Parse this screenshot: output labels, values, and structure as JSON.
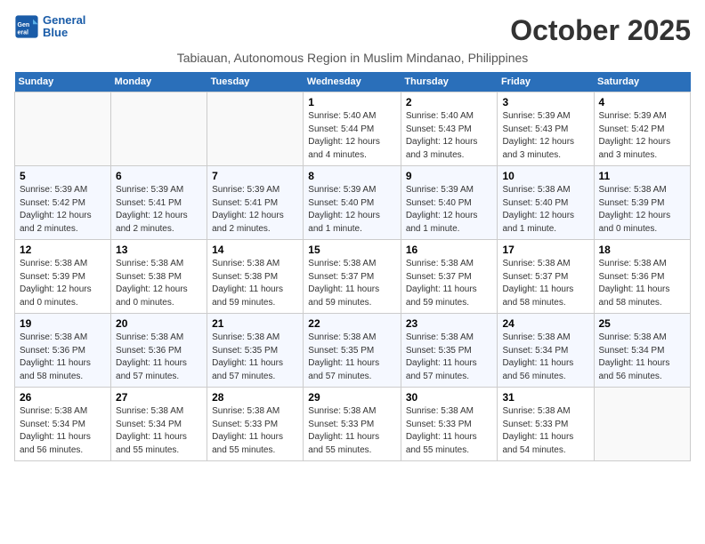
{
  "logo": {
    "line1": "General",
    "line2": "Blue"
  },
  "title": "October 2025",
  "subtitle": "Tabiauan, Autonomous Region in Muslim Mindanao, Philippines",
  "days_of_week": [
    "Sunday",
    "Monday",
    "Tuesday",
    "Wednesday",
    "Thursday",
    "Friday",
    "Saturday"
  ],
  "weeks": [
    [
      {
        "day": "",
        "info": ""
      },
      {
        "day": "",
        "info": ""
      },
      {
        "day": "",
        "info": ""
      },
      {
        "day": "1",
        "info": "Sunrise: 5:40 AM\nSunset: 5:44 PM\nDaylight: 12 hours and 4 minutes."
      },
      {
        "day": "2",
        "info": "Sunrise: 5:40 AM\nSunset: 5:43 PM\nDaylight: 12 hours and 3 minutes."
      },
      {
        "day": "3",
        "info": "Sunrise: 5:39 AM\nSunset: 5:43 PM\nDaylight: 12 hours and 3 minutes."
      },
      {
        "day": "4",
        "info": "Sunrise: 5:39 AM\nSunset: 5:42 PM\nDaylight: 12 hours and 3 minutes."
      }
    ],
    [
      {
        "day": "5",
        "info": "Sunrise: 5:39 AM\nSunset: 5:42 PM\nDaylight: 12 hours and 2 minutes."
      },
      {
        "day": "6",
        "info": "Sunrise: 5:39 AM\nSunset: 5:41 PM\nDaylight: 12 hours and 2 minutes."
      },
      {
        "day": "7",
        "info": "Sunrise: 5:39 AM\nSunset: 5:41 PM\nDaylight: 12 hours and 2 minutes."
      },
      {
        "day": "8",
        "info": "Sunrise: 5:39 AM\nSunset: 5:40 PM\nDaylight: 12 hours and 1 minute."
      },
      {
        "day": "9",
        "info": "Sunrise: 5:39 AM\nSunset: 5:40 PM\nDaylight: 12 hours and 1 minute."
      },
      {
        "day": "10",
        "info": "Sunrise: 5:38 AM\nSunset: 5:40 PM\nDaylight: 12 hours and 1 minute."
      },
      {
        "day": "11",
        "info": "Sunrise: 5:38 AM\nSunset: 5:39 PM\nDaylight: 12 hours and 0 minutes."
      }
    ],
    [
      {
        "day": "12",
        "info": "Sunrise: 5:38 AM\nSunset: 5:39 PM\nDaylight: 12 hours and 0 minutes."
      },
      {
        "day": "13",
        "info": "Sunrise: 5:38 AM\nSunset: 5:38 PM\nDaylight: 12 hours and 0 minutes."
      },
      {
        "day": "14",
        "info": "Sunrise: 5:38 AM\nSunset: 5:38 PM\nDaylight: 11 hours and 59 minutes."
      },
      {
        "day": "15",
        "info": "Sunrise: 5:38 AM\nSunset: 5:37 PM\nDaylight: 11 hours and 59 minutes."
      },
      {
        "day": "16",
        "info": "Sunrise: 5:38 AM\nSunset: 5:37 PM\nDaylight: 11 hours and 59 minutes."
      },
      {
        "day": "17",
        "info": "Sunrise: 5:38 AM\nSunset: 5:37 PM\nDaylight: 11 hours and 58 minutes."
      },
      {
        "day": "18",
        "info": "Sunrise: 5:38 AM\nSunset: 5:36 PM\nDaylight: 11 hours and 58 minutes."
      }
    ],
    [
      {
        "day": "19",
        "info": "Sunrise: 5:38 AM\nSunset: 5:36 PM\nDaylight: 11 hours and 58 minutes."
      },
      {
        "day": "20",
        "info": "Sunrise: 5:38 AM\nSunset: 5:36 PM\nDaylight: 11 hours and 57 minutes."
      },
      {
        "day": "21",
        "info": "Sunrise: 5:38 AM\nSunset: 5:35 PM\nDaylight: 11 hours and 57 minutes."
      },
      {
        "day": "22",
        "info": "Sunrise: 5:38 AM\nSunset: 5:35 PM\nDaylight: 11 hours and 57 minutes."
      },
      {
        "day": "23",
        "info": "Sunrise: 5:38 AM\nSunset: 5:35 PM\nDaylight: 11 hours and 57 minutes."
      },
      {
        "day": "24",
        "info": "Sunrise: 5:38 AM\nSunset: 5:34 PM\nDaylight: 11 hours and 56 minutes."
      },
      {
        "day": "25",
        "info": "Sunrise: 5:38 AM\nSunset: 5:34 PM\nDaylight: 11 hours and 56 minutes."
      }
    ],
    [
      {
        "day": "26",
        "info": "Sunrise: 5:38 AM\nSunset: 5:34 PM\nDaylight: 11 hours and 56 minutes."
      },
      {
        "day": "27",
        "info": "Sunrise: 5:38 AM\nSunset: 5:34 PM\nDaylight: 11 hours and 55 minutes."
      },
      {
        "day": "28",
        "info": "Sunrise: 5:38 AM\nSunset: 5:33 PM\nDaylight: 11 hours and 55 minutes."
      },
      {
        "day": "29",
        "info": "Sunrise: 5:38 AM\nSunset: 5:33 PM\nDaylight: 11 hours and 55 minutes."
      },
      {
        "day": "30",
        "info": "Sunrise: 5:38 AM\nSunset: 5:33 PM\nDaylight: 11 hours and 55 minutes."
      },
      {
        "day": "31",
        "info": "Sunrise: 5:38 AM\nSunset: 5:33 PM\nDaylight: 11 hours and 54 minutes."
      },
      {
        "day": "",
        "info": ""
      }
    ]
  ]
}
